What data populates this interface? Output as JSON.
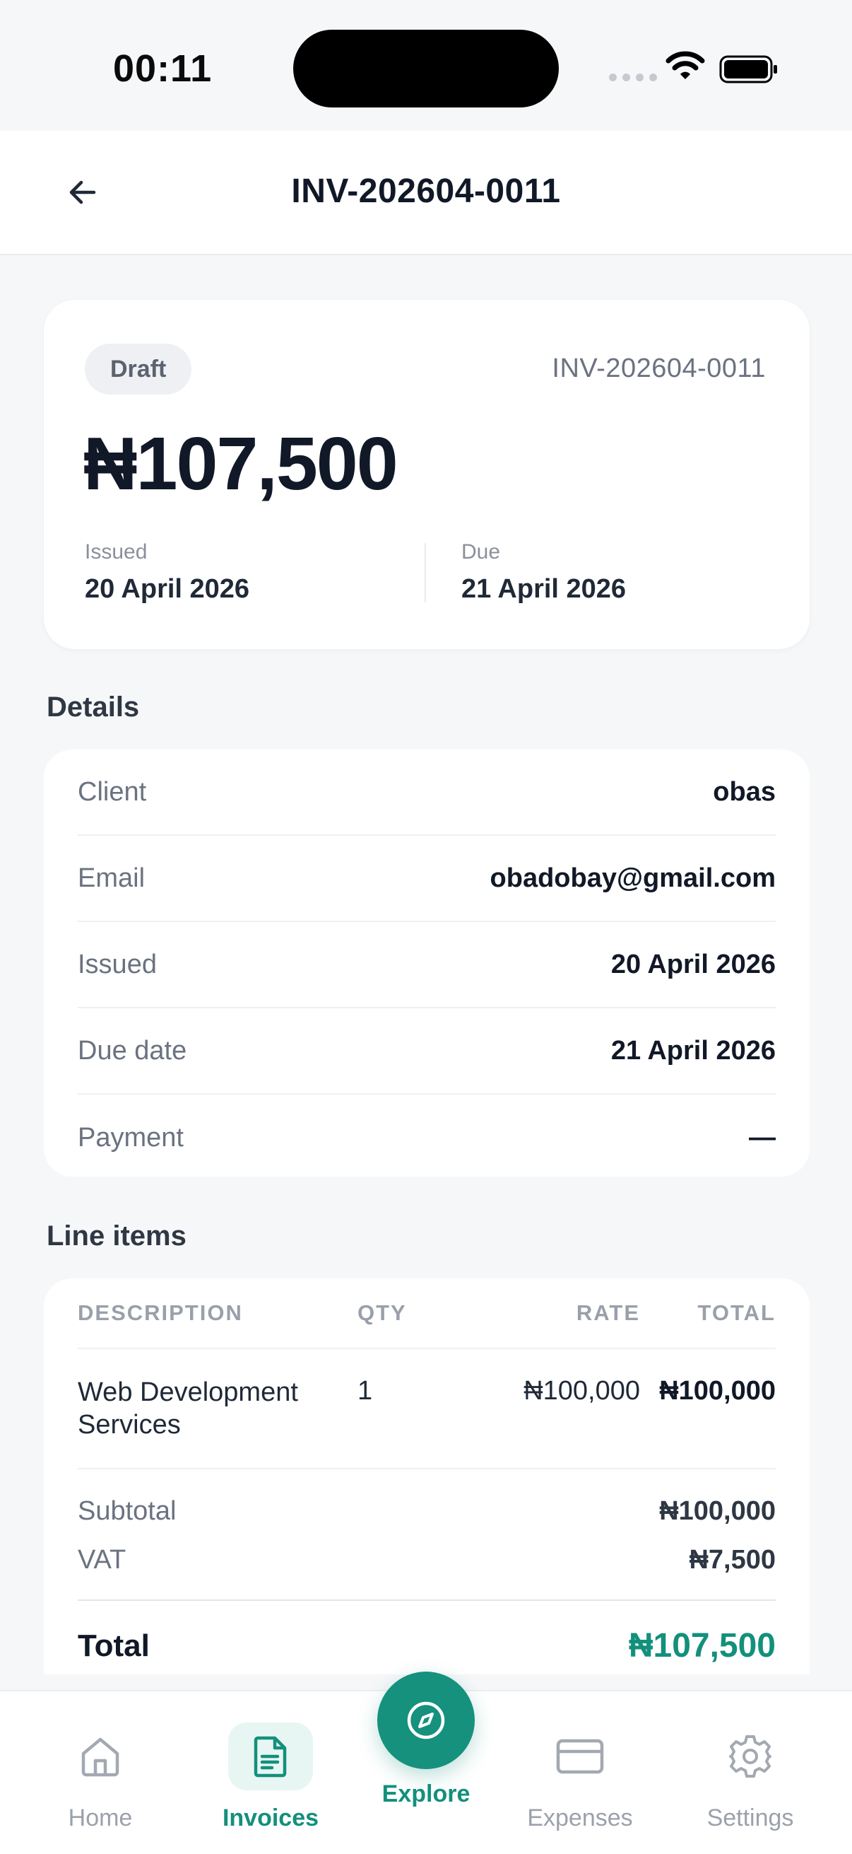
{
  "status_bar": {
    "time": "00:11"
  },
  "header": {
    "title": "INV-202604-0011"
  },
  "summary": {
    "status": "Draft",
    "invoice_number": "INV-202604-0011",
    "amount": "₦107,500",
    "issued_label": "Issued",
    "issued_value": "20 April 2026",
    "due_label": "Due",
    "due_value": "21 April 2026"
  },
  "details": {
    "title": "Details",
    "rows": [
      {
        "label": "Client",
        "value": "obas"
      },
      {
        "label": "Email",
        "value": "obadobay@gmail.com"
      },
      {
        "label": "Issued",
        "value": "20 April 2026"
      },
      {
        "label": "Due date",
        "value": "21 April 2026"
      },
      {
        "label": "Payment",
        "value": "—"
      }
    ]
  },
  "line_items": {
    "title": "Line items",
    "headers": {
      "description": "DESCRIPTION",
      "qty": "QTY",
      "rate": "RATE",
      "total": "TOTAL"
    },
    "items": [
      {
        "description": "Web Development Services",
        "qty": "1",
        "rate": "₦100,000",
        "total": "₦100,000"
      }
    ],
    "subtotal_label": "Subtotal",
    "subtotal_value": "₦100,000",
    "vat_label": "VAT",
    "vat_value": "₦7,500",
    "total_label": "Total",
    "total_value": "₦107,500"
  },
  "nav": {
    "home": "Home",
    "invoices": "Invoices",
    "explore": "Explore",
    "expenses": "Expenses",
    "settings": "Settings"
  },
  "colors": {
    "accent": "#13907c",
    "text_primary": "#111827",
    "text_muted": "#6b7280",
    "background": "#f6f7f9"
  }
}
